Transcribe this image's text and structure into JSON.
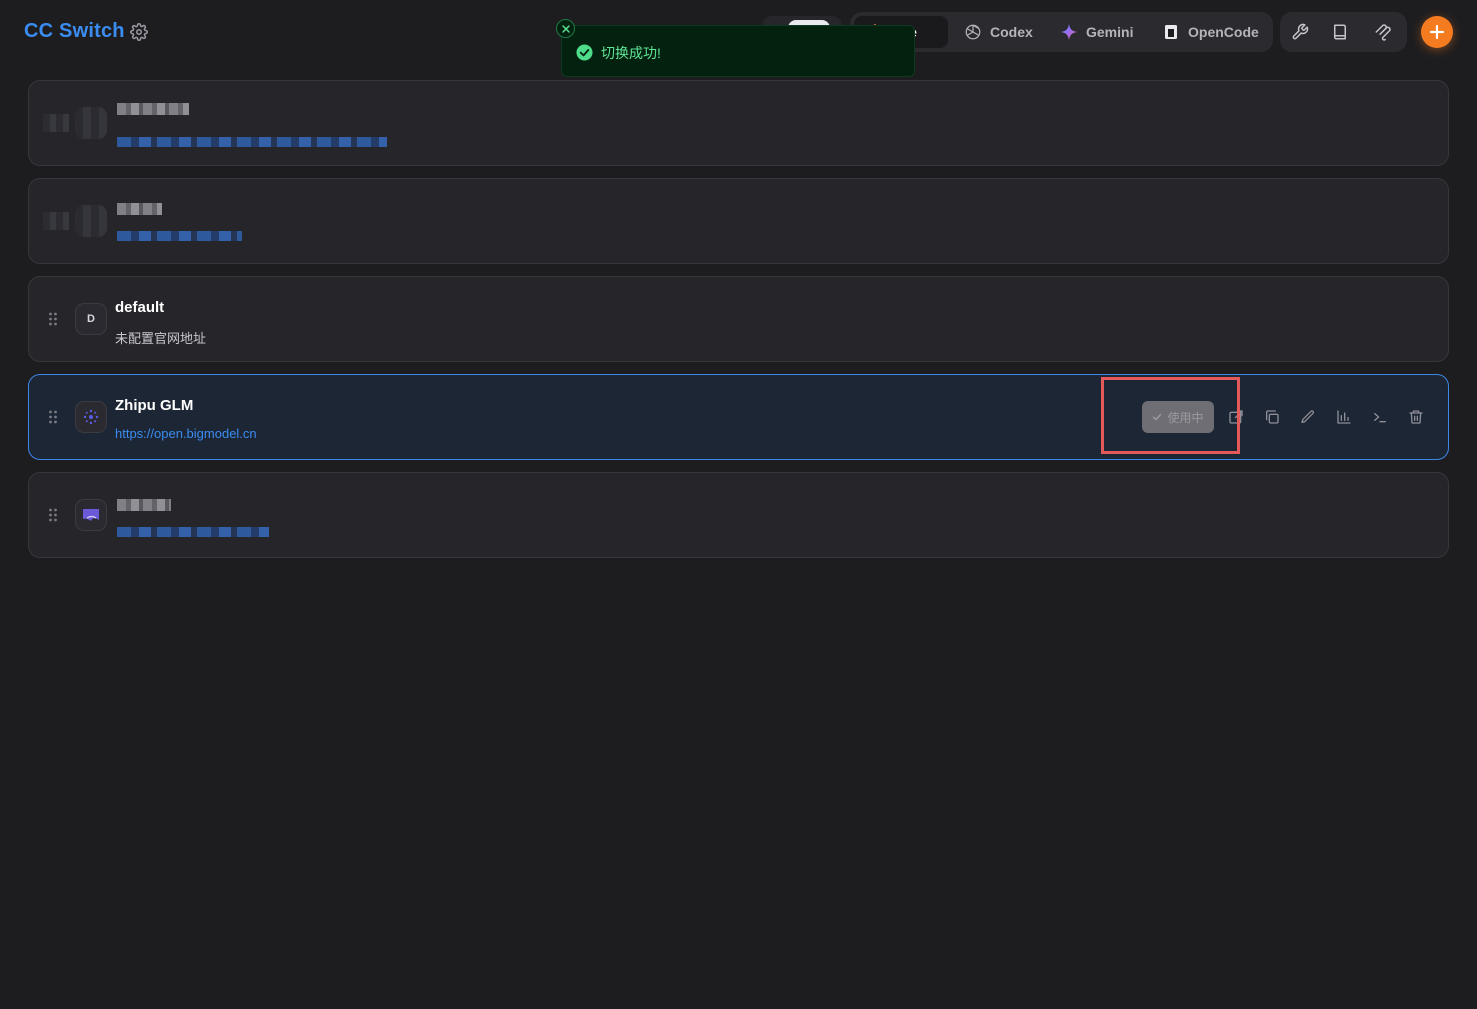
{
  "header": {
    "title": "CC Switch",
    "settings_icon": "gear-icon",
    "app_tabs": [
      {
        "label": "Claude",
        "visible_label": "ude",
        "icon": "claude-icon",
        "active": true
      },
      {
        "label": "Codex",
        "icon": "openai-icon",
        "active": false
      },
      {
        "label": "Gemini",
        "icon": "gemini-sparkle-icon",
        "active": false
      },
      {
        "label": "OpenCode",
        "icon": "opencode-icon",
        "active": false
      }
    ],
    "tools": [
      "wrench-icon",
      "book-icon",
      "mcp-icon"
    ],
    "add_icon": "plus-icon",
    "colors": {
      "accent": "#3b8cf0",
      "add_button": "#f47b20"
    }
  },
  "toast": {
    "message": "切换成功!",
    "status": "success",
    "icon": "check-circle-icon",
    "close_icon": "close-icon",
    "color": "#5fe394"
  },
  "providers": [
    {
      "name": "",
      "url": "",
      "redacted": true,
      "active": false
    },
    {
      "name": "",
      "url": "",
      "redacted": true,
      "active": false
    },
    {
      "name": "default",
      "avatar": "D",
      "url": "未配置官网地址",
      "url_is_link": false,
      "active": false
    },
    {
      "name": "Zhipu GLM",
      "url": "https://open.bigmodel.cn",
      "url_is_link": true,
      "active": true,
      "avatar_icon": "zhipu-logo-icon",
      "use_button": "使用中",
      "actions": [
        "external-link-icon",
        "copy-icon",
        "edit-icon",
        "chart-icon",
        "terminal-icon",
        "trash-icon"
      ]
    },
    {
      "name": "",
      "url": "",
      "redacted": true,
      "active": false,
      "avatar_icon": "provider-logo-icon"
    }
  ]
}
